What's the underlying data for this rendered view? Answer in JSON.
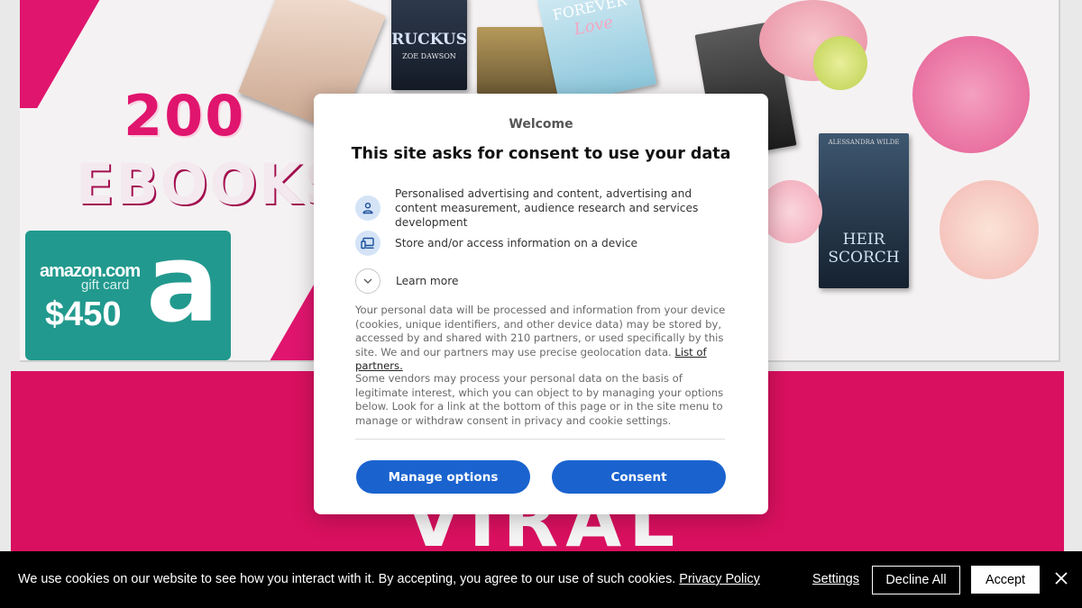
{
  "hero": {
    "count_text": "200",
    "ebooks_text": "EBOOKS",
    "giftcard": {
      "brand": "amazon.com",
      "sub": "gift card",
      "amount": "$450",
      "logo_letter": "a"
    },
    "books": [
      {
        "title": "RUCKUS",
        "author": "ZOE DAWSON"
      },
      {
        "title": "FOREVER",
        "subtitle": "Love"
      },
      {
        "title": "HEIR",
        "subtitle": "SCORCH",
        "author": "ALESSANDRA WILDE"
      }
    ],
    "section_title": "VIRAL",
    "colors": {
      "pink": "#e0156e",
      "teal": "#22998e",
      "section_pink": "#d9105f"
    }
  },
  "consent": {
    "welcome": "Welcome",
    "heading": "This site asks for consent to use your data",
    "purposes": [
      {
        "icon": "person-icon",
        "text": "Personalised advertising and content, advertising and content measurement, audience research and services development"
      },
      {
        "icon": "devices-icon",
        "text": "Store and/or access information on a device"
      }
    ],
    "learn_more": "Learn more",
    "paragraph1": "Your personal data will be processed and information from your device (cookies, unique identifiers, and other device data) may be stored by, accessed by and shared with 210 partners, or used specifically by this site. We and our partners may use precise geolocation data.",
    "partners_link": "List of partners.",
    "paragraph2": "Some vendors may process your personal data on the basis of legitimate interest, which you can object to by managing your options below. Look for a link at the bottom of this page or in the site menu to manage or withdraw consent in privacy and cookie settings.",
    "manage_button": "Manage options",
    "consent_button": "Consent",
    "accent": "#1a63cf"
  },
  "cookie_bar": {
    "text": "We use cookies on our website to see how you interact with it. By accepting, you agree to our use of such cookies.",
    "privacy_link": "Privacy Policy",
    "settings": "Settings",
    "decline": "Decline All",
    "accept": "Accept",
    "close_icon": "close-icon"
  }
}
